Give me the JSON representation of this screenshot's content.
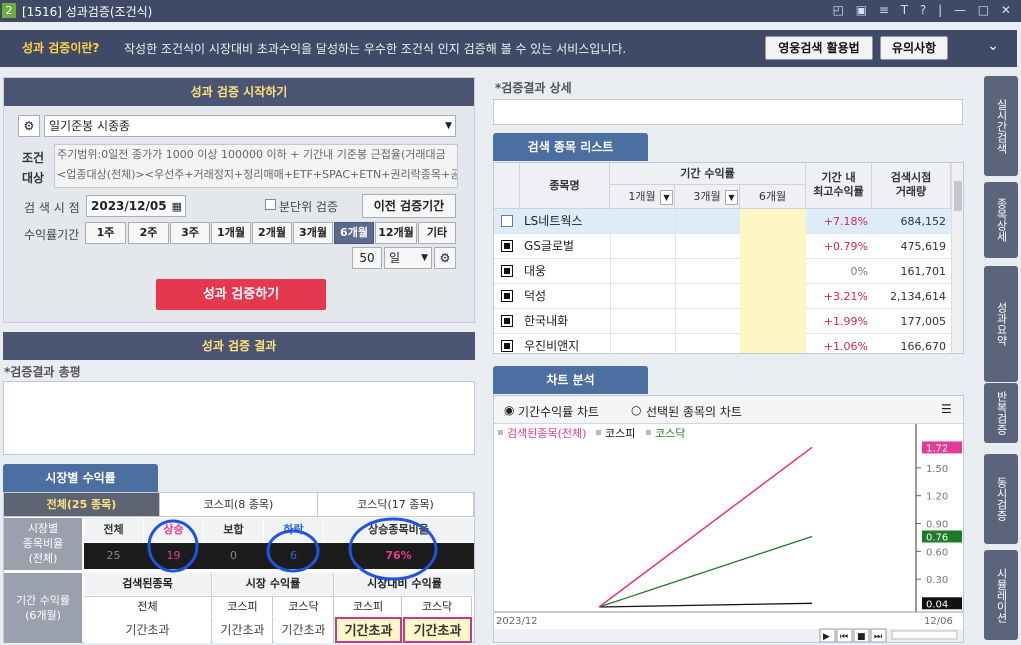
{
  "window": {
    "number": "2",
    "title": "[1516] 성과검증(조건식)",
    "controls": "◰ ▣ ≡ T ? | — □ ✕"
  },
  "banner": {
    "question": "성과 검증이란?",
    "description": "작성한 조건식이 시장대비 초과수익을 달성하는 우수한 조건식 인지 검증해 볼 수 있는 서비스입니다.",
    "video_button": "영웅검색 활용법",
    "notice_button": "유의사항"
  },
  "start": {
    "header": "성과 검증 시작하기",
    "condition_select": "일기준봉 시종종",
    "condition_label": "조건\n대상",
    "condition_line1": "주기범위:0일전 종가가 1000 이상 100000 이하 + 기간내 기준봉 근접율(거래대금",
    "condition_line2": "<업종대상(전체)><우선주+거래정지+정리매매+ETF+SPAC+ETN+권리락종목+공",
    "search_date_label": "검 색 시 점",
    "search_date": "2023/12/05",
    "minute_check": "분단위 검증",
    "prev_button": "이전 검증기간",
    "period_label": "수익률기간",
    "periods": [
      "1주",
      "2주",
      "3주",
      "1개월",
      "2개월",
      "3개월",
      "6개월",
      "12개월",
      "기타"
    ],
    "active_period": "6개월",
    "days_value": "50",
    "days_unit": "일",
    "run_button": "성과 검증하기"
  },
  "result": {
    "header": "성과 검증 결과",
    "summary_label": "*검증결과 총평"
  },
  "market": {
    "tab": "시장별 수익률",
    "subtabs": [
      "전체(25 종목)",
      "코스피(8 종목)",
      "코스닥(17 종목)"
    ],
    "ratio_label": "시장별\n종목비율\n(전체)",
    "ratio_headers": [
      "전체",
      "상승",
      "보합",
      "하락",
      "상승종목비율"
    ],
    "ratio_values": [
      "25",
      "19",
      "0",
      "6",
      "76%"
    ],
    "period_label": "기간 수익률\n(6개월)",
    "group_headers": [
      "검색된종목",
      "시장 수익률",
      "시장대비 수익률"
    ],
    "sub_headers": [
      "전체",
      "코스피",
      "코스닥",
      "코스피",
      "코스닥"
    ],
    "values": [
      "기간초과",
      "기간초과",
      "기간초과",
      "기간초과",
      "기간초과"
    ]
  },
  "detail": {
    "label": "*검증결과 상세"
  },
  "list": {
    "tab": "검색 종목 리스트",
    "headers": {
      "name": "종목명",
      "period_return": "기간 수익률",
      "m1": "1개월",
      "m3": "3개월",
      "m6": "6개월",
      "max": "기간 내\n최고수익률",
      "volume": "검색시점\n거래량"
    },
    "rows": [
      {
        "name": "LS네트웍스",
        "max": "+7.18%",
        "volume": "684,152"
      },
      {
        "name": "GS글로벌",
        "max": "+0.79%",
        "volume": "475,619"
      },
      {
        "name": "대웅",
        "max": "0%",
        "volume": "161,701"
      },
      {
        "name": "덕성",
        "max": "+3.21%",
        "volume": "2,134,614"
      },
      {
        "name": "한국내화",
        "max": "+1.99%",
        "volume": "177,005"
      },
      {
        "name": "우진비앤지",
        "max": "+1.06%",
        "volume": "166,670"
      }
    ]
  },
  "chart": {
    "tab": "차트 분석",
    "radio1": "기간수익률 차트",
    "radio2": "선택된 종목의 차트",
    "start_label": "2023/12",
    "end_label": "12/06",
    "colors": {
      "selected": "#e23c96",
      "kospi": "#111111",
      "kosdaq": "#1f7a2a"
    }
  },
  "chart_data": {
    "type": "line",
    "x": [
      "2023/12",
      "12/06"
    ],
    "series": [
      {
        "name": "검색된종목(전체)",
        "values": [
          0,
          1.72
        ]
      },
      {
        "name": "코스피",
        "values": [
          0,
          0.04
        ]
      },
      {
        "name": "코스닥",
        "values": [
          0,
          0.76
        ]
      }
    ],
    "yticks": [
      1.5,
      1.2,
      0.9,
      0.6,
      0.3
    ],
    "ylim": [
      0,
      1.8
    ],
    "end_labels": [
      "1.72",
      "0.76",
      "0.04"
    ],
    "legend": "top-left",
    "grid": false
  },
  "sidebar": {
    "tabs": [
      "실시간검색",
      "종목상세",
      "성과요약",
      "반복검증",
      "동시검증",
      "시뮬레이션"
    ]
  }
}
